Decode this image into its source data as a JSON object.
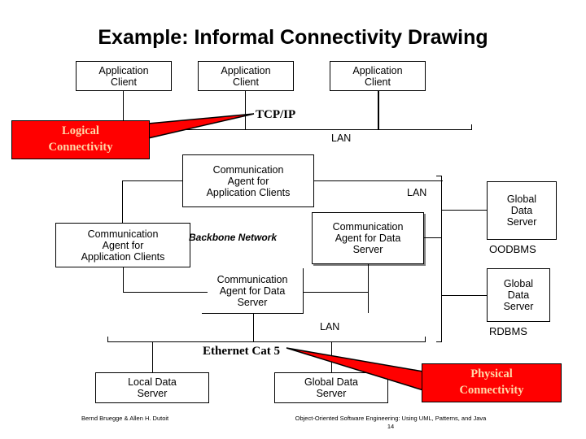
{
  "slide": {
    "title": "Example: Informal Connectivity Drawing",
    "page_number": "14"
  },
  "callouts": {
    "logical": {
      "line1": "Logical",
      "line2": "Connectivity",
      "color": "#FF0000",
      "text_color": "#FFD8A8"
    },
    "physical": {
      "line1": "Physical",
      "line2": "Connectivity",
      "color": "#FF0000",
      "text_color": "#FFD8A8"
    }
  },
  "network_labels": {
    "tcpip": "TCP/IP",
    "lan_top": "LAN",
    "lan_middle": "LAN",
    "lan_bottom": "LAN",
    "backbone": "Backbone Network",
    "ethernet": "Ethernet Cat 5"
  },
  "nodes": {
    "app_client_1": {
      "line1": "Application",
      "line2": "Client"
    },
    "app_client_2": {
      "line1": "Application",
      "line2": "Client"
    },
    "app_client_3": {
      "line1": "Application",
      "line2": "Client"
    },
    "comm_agent_app_top": {
      "line1": "Communication",
      "line2": "Agent for",
      "line3": "Application Clients"
    },
    "comm_agent_app_left": {
      "line1": "Communication",
      "line2": "Agent for",
      "line3": "Application Clients"
    },
    "comm_agent_data_right": {
      "line1": "Communication",
      "line2": "Agent for Data",
      "line3": "Server"
    },
    "comm_agent_data_mid": {
      "line1": "Communication",
      "line2": "Agent for Data",
      "line3": "Server"
    },
    "global_data_server_oodbms": {
      "line1": "Global",
      "line2": "Data",
      "line3": "Server"
    },
    "global_data_server_rdbms": {
      "line1": "Global",
      "line2": "Data",
      "line3": "Server"
    },
    "local_data_server": {
      "line1": "Local Data",
      "line2": "Server"
    },
    "global_data_server_bottom": {
      "line1": "Global Data",
      "line2": "Server"
    }
  },
  "db_labels": {
    "oodbms": "OODBMS",
    "rdbms": "RDBMS"
  },
  "footer": {
    "authors": "Bernd Bruegge & Allen H. Dutoit",
    "book": "Object-Oriented Software Engineering: Using UML, Patterns, and Java"
  }
}
